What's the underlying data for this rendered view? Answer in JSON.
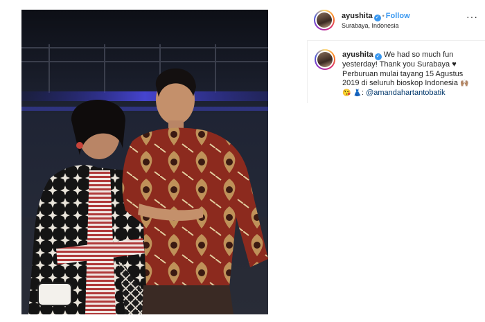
{
  "post": {
    "username": "ayushita",
    "verified_badge": "✓",
    "separator": "•",
    "follow_label": "Follow",
    "location": "Surabaya, Indonesia",
    "more_label": "···"
  },
  "caption": {
    "username": "ayushita",
    "text_1": "We had so much fun yesterday! Thank you Surabaya",
    "heart": "♥",
    "text_2": "Perburuan mulai tayang 15 Agustus 2019 di seluruh bioskop Indonesia",
    "emoji_1": "🙌🏽",
    "emoji_2": "😘",
    "emoji_3": "👗",
    "credit_prefix": ":",
    "mention": "@amandahartantobatik"
  },
  "colors": {
    "accent_blue": "#3897f0",
    "mention_blue": "#00376b",
    "photo_bg": "#1a1d28"
  },
  "icons": {
    "verified": "verified-badge-icon",
    "more": "more-options-icon"
  }
}
